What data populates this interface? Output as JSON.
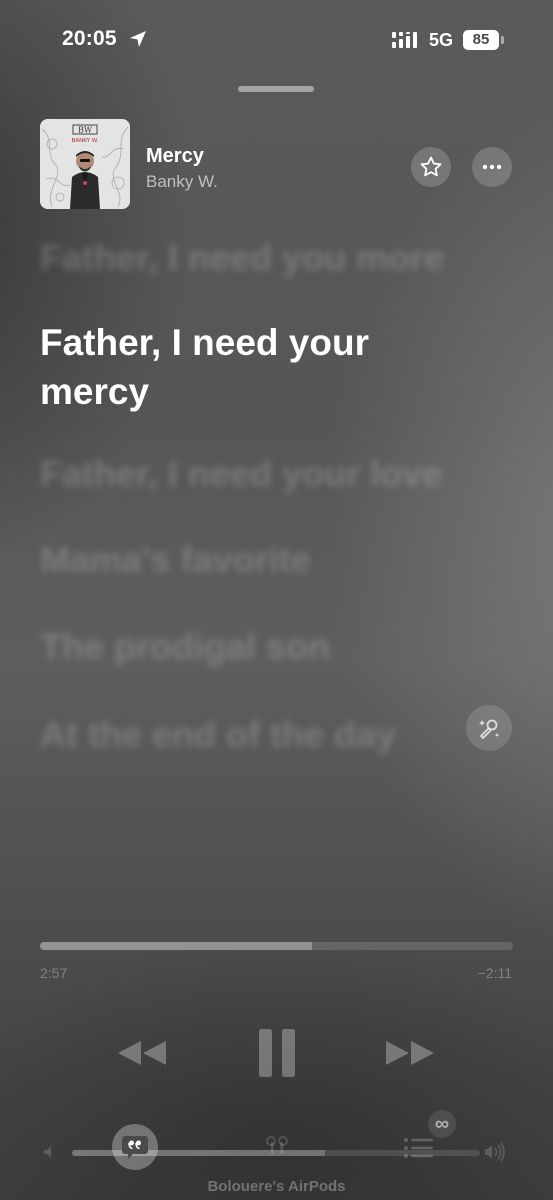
{
  "status_bar": {
    "time": "20:05",
    "network": "5G",
    "battery": "85"
  },
  "now_playing": {
    "album_art_text": "BW BANKY W.",
    "title": "Mercy",
    "artist": "Banky W.",
    "icons": {
      "favorite": "star-icon",
      "more": "ellipsis-icon"
    }
  },
  "lyrics": {
    "previous": "Father, I need you more",
    "current": "Father, I need your mercy",
    "upcoming": [
      "Father, I need your love",
      "Mama's favorite",
      "The prodigal son",
      "At the end of the day"
    ],
    "singalong_icon": "microphone-sparkle-icon"
  },
  "playback": {
    "elapsed": "2:57",
    "remaining": "−2:11",
    "progress_fraction": 0.575,
    "volume_fraction": 0.62
  },
  "controls": {
    "rewind_icon": "backward-icon",
    "pause_icon": "pause-icon",
    "forward_icon": "forward-icon"
  },
  "bottom_bar": {
    "lyrics_icon": "quote-bubble-icon",
    "airplay_icon": "airpods-icon",
    "queue_icon": "list-icon",
    "autoplay_badge": "∞",
    "output_device": "Bolouere's AirPods"
  },
  "colors": {
    "background": "#575757",
    "text_primary": "#ffffff"
  }
}
